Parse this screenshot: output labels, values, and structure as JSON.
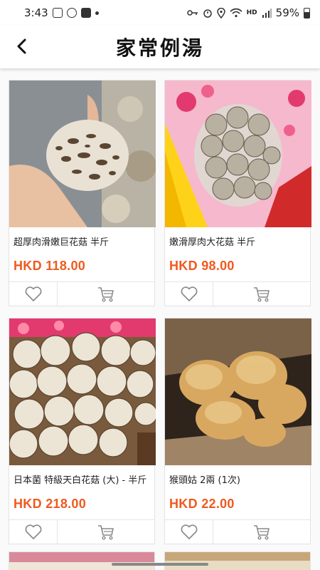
{
  "status_bar": {
    "time": "3:43",
    "battery": "59%",
    "network": "HD"
  },
  "header": {
    "title": "家常例湯"
  },
  "products": [
    {
      "name": "超厚肉滑嫩巨花菇 半斤",
      "price": "HKD 118.00"
    },
    {
      "name": "嫩滑厚肉大花菇 半斤",
      "price": "HKD 98.00"
    },
    {
      "name": "日本菌 特級天白花菇 (大) - 半斤",
      "price": "HKD 218.00"
    },
    {
      "name": "猴頭姑 2兩 (1次)",
      "price": "HKD 22.00"
    }
  ],
  "icons": {
    "back": "chevron-left-icon",
    "favorite": "heart-outline-icon",
    "cart": "shopping-cart-icon"
  },
  "colors": {
    "price": "#ef5a1f",
    "icon": "#888888"
  }
}
